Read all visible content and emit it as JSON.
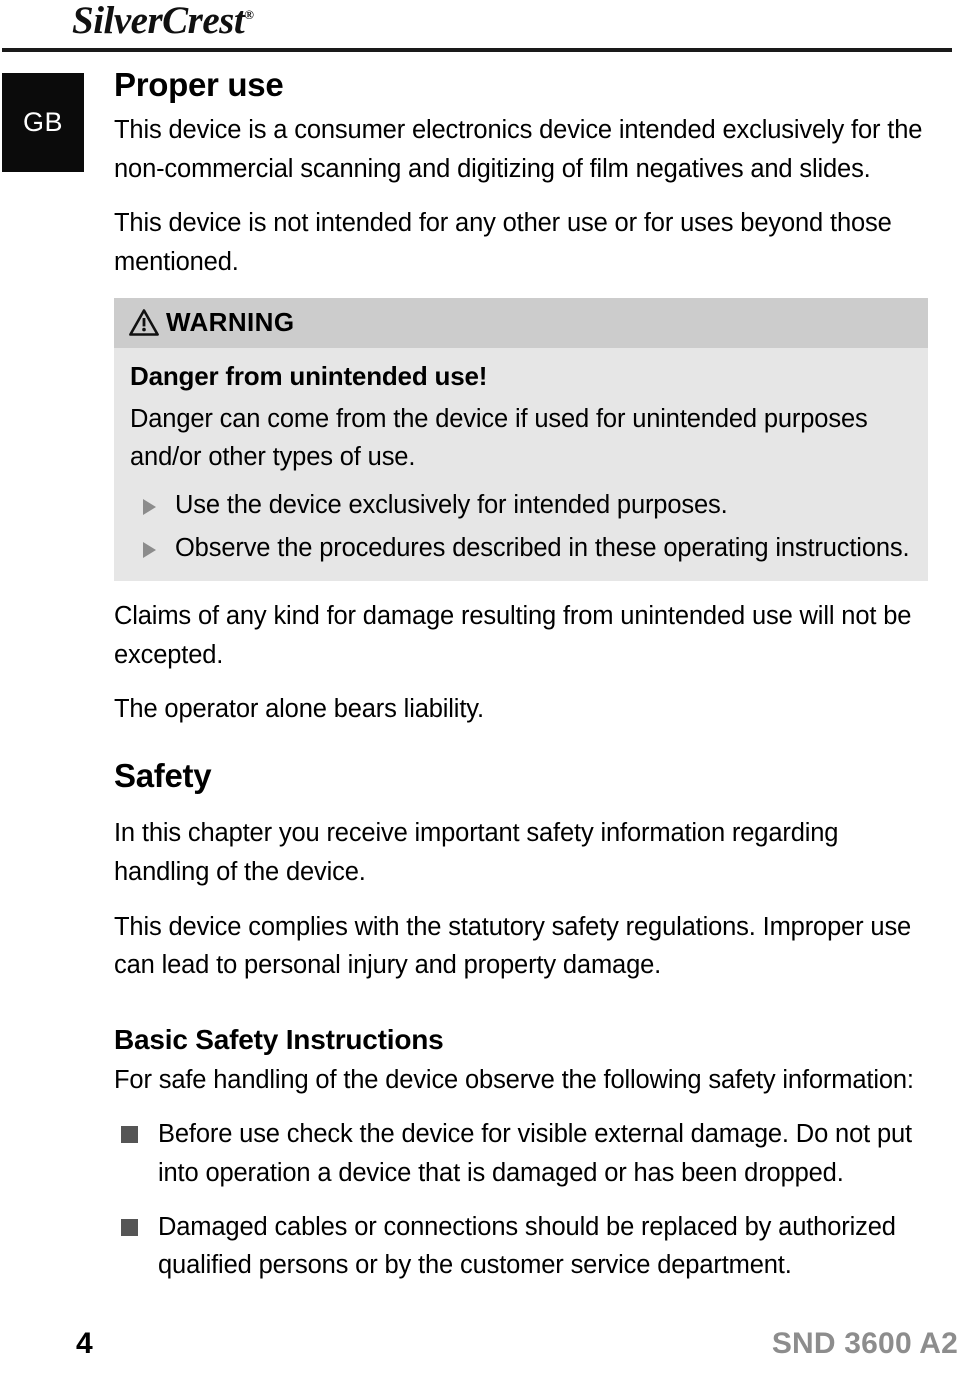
{
  "header": {
    "brand_part1": "Silver",
    "brand_part2": "Crest",
    "brand_registered": "®",
    "country_code": "GB"
  },
  "main": {
    "section_title": "Proper use",
    "intro_paragraph_1": "This device is a consumer electronics device intended exclusively for the non-commercial scanning and digitizing of film negatives and slides.",
    "intro_paragraph_2": "This device is not intended for any other use or for uses beyond those mentioned.",
    "warning": {
      "label": "WARNING",
      "icon": "warning-triangle-icon",
      "heading": "Danger from unintended use!",
      "paragraph": "Danger can come from the device if used for unintended purposes and/or other types of use.",
      "items": [
        "Use the device exclusively for intended purposes.",
        "Observe the procedures described in these operating instructions."
      ]
    },
    "after_warning_paragraph_1": "Claims of any kind for damage resulting from unintended use will not be excepted.",
    "after_warning_paragraph_2": "The operator alone bears liability.",
    "safety_title": "Safety",
    "safety_paragraph_1": "In this chapter you receive important safety information regarding handling of the device.",
    "safety_paragraph_2": "This device complies with the statutory safety regulations. Improper use can lead to personal injury and property damage.",
    "basic_safety_title": "Basic Safety Instructions",
    "basic_safety_intro": "For safe handling of the device observe the following safety information:",
    "basic_safety_items": [
      "Before use check the device for visible external damage. Do not put into operation a device that is damaged or has been dropped.",
      "Damaged cables or connections should be replaced by authorized qualified persons or by the customer service department."
    ]
  },
  "footer": {
    "page_number": "4",
    "model": "SND 3600 A2"
  },
  "colors": {
    "warning_header_bg": "#cccccc",
    "warning_body_bg": "#e6e6e6",
    "badge_bg": "#0b0b0b",
    "model_gray": "#8d8d8d",
    "bullet_gray": "#555555",
    "arrow_gray": "#8c8c8c"
  }
}
